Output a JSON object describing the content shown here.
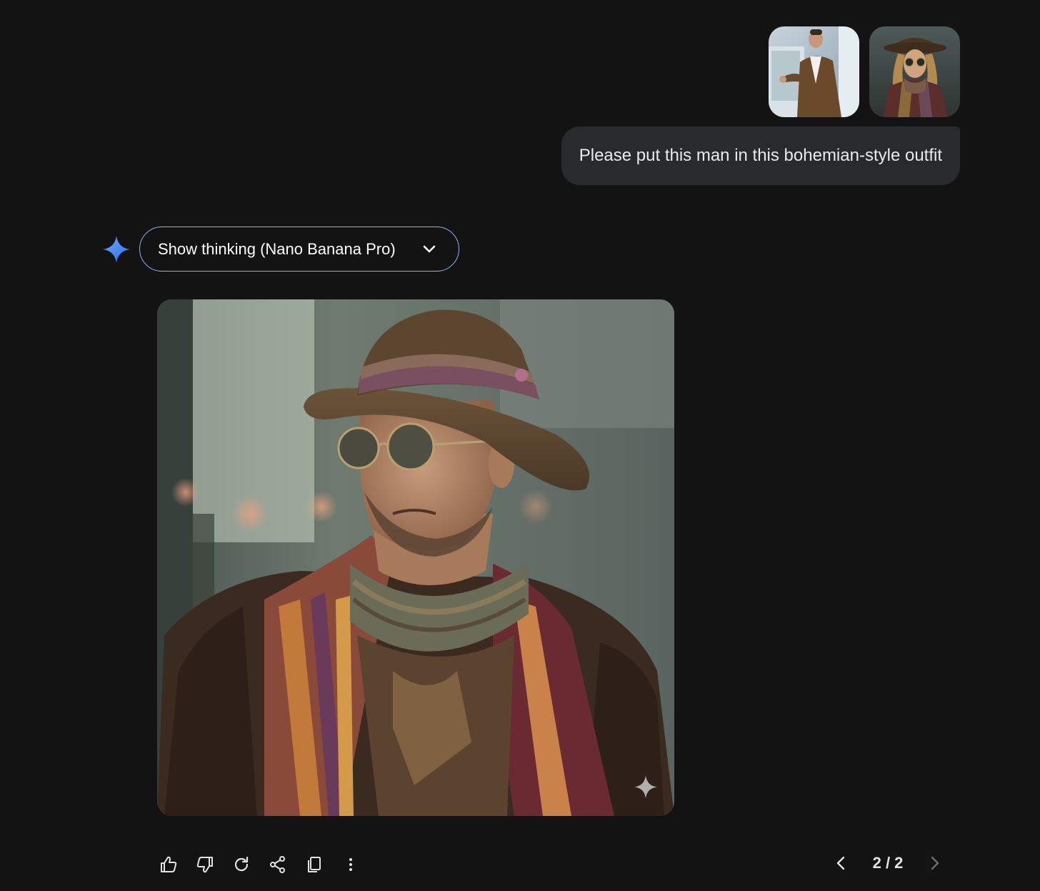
{
  "user_message": {
    "attachments": [
      {
        "icon": "photo-man-presenting-thumbnail"
      },
      {
        "icon": "photo-bohemian-outfit-thumbnail"
      }
    ],
    "text": "Please put this man in this bohemian-style outfit"
  },
  "response": {
    "thinking_toggle_label": "Show thinking (Nano Banana Pro)",
    "image_icon": "generated-portrait-image",
    "actions": [
      {
        "name": "thumbs-up-icon"
      },
      {
        "name": "thumbs-down-icon"
      },
      {
        "name": "regenerate-icon"
      },
      {
        "name": "share-icon"
      },
      {
        "name": "copy-icon"
      },
      {
        "name": "more-options-icon"
      }
    ],
    "pager": {
      "label": "2 / 2"
    }
  },
  "colors": {
    "background": "#131314",
    "bubble": "#282a2c",
    "accent_border": "#8ab4f8",
    "spark_blue": "#4285f4"
  }
}
